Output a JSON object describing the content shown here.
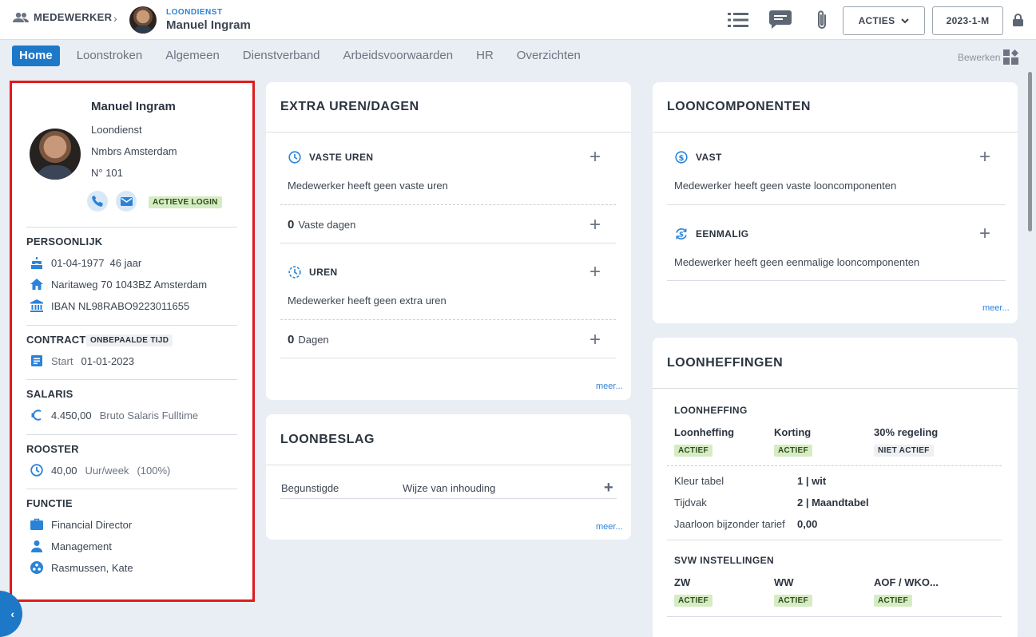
{
  "breadcrumb": {
    "root": "MEDEWERKER",
    "department": "LOONDIENST",
    "employee": "Manuel Ingram"
  },
  "toolbar": {
    "acties": "ACTIES",
    "period": "2023-1-M"
  },
  "tabs": [
    "Home",
    "Loonstroken",
    "Algemeen",
    "Dienstverband",
    "Arbeidsvoorwaarden",
    "HR",
    "Overzichten"
  ],
  "bewerken": "Bewerken",
  "profile": {
    "name": "Manuel Ingram",
    "department": "Loondienst",
    "company": "Nmbrs Amsterdam",
    "number": "N° 101",
    "login_badge": "ACTIEVE LOGIN",
    "persoonlijk": {
      "title": "PERSOONLIJK",
      "birthdate": "01-04-1977",
      "age": "46 jaar",
      "address": "Naritaweg 70 1043BZ Amsterdam",
      "iban": "IBAN NL98RABO9223011655"
    },
    "contract": {
      "title": "CONTRACT",
      "badge": "ONBEPAALDE TIJD",
      "start_label": "Start",
      "start_date": "01-01-2023"
    },
    "salaris": {
      "title": "SALARIS",
      "amount": "4.450,00",
      "type": "Bruto Salaris Fulltime"
    },
    "rooster": {
      "title": "ROOSTER",
      "hours": "40,00",
      "unit": "Uur/week",
      "percent": "(100%)"
    },
    "functie": {
      "title": "FUNCTIE",
      "job": "Financial Director",
      "department": "Management",
      "manager": "Rasmussen, Kate"
    }
  },
  "extra_uren": {
    "title": "EXTRA UREN/DAGEN",
    "vaste_uren": "VASTE UREN",
    "vaste_uren_empty": "Medewerker heeft geen vaste uren",
    "vaste_dagen_count": "0",
    "vaste_dagen_label": "Vaste dagen",
    "uren": "UREN",
    "uren_empty": "Medewerker heeft geen extra uren",
    "dagen_count": "0",
    "dagen_label": "Dagen",
    "meer": "meer..."
  },
  "loonbeslag": {
    "title": "LOONBESLAG",
    "col_begunstigde": "Begunstigde",
    "col_wijze": "Wijze van inhouding",
    "meer": "meer..."
  },
  "looncomponenten": {
    "title": "LOONCOMPONENTEN",
    "vast": "VAST",
    "vast_empty": "Medewerker heeft geen vaste looncomponenten",
    "eenmalig": "EENMALIG",
    "eenmalig_empty": "Medewerker heeft geen eenmalige looncomponenten",
    "meer": "meer..."
  },
  "loonheffingen": {
    "title": "LOONHEFFINGEN",
    "section": "LOONHEFFING",
    "items": [
      {
        "label": "Loonheffing",
        "status": "ACTIEF"
      },
      {
        "label": "Korting",
        "status": "ACTIEF"
      },
      {
        "label": "30% regeling",
        "status": "NIET ACTIEF"
      }
    ],
    "kleur_label": "Kleur tabel",
    "kleur_value": "1 | wit",
    "tijdvak_label": "Tijdvak",
    "tijdvak_value": "2 | Maandtabel",
    "jaarloon_label": "Jaarloon bijzonder tarief",
    "jaarloon_value": "0,00",
    "svw_title": "SVW INSTELLINGEN",
    "svw": [
      {
        "label": "ZW",
        "status": "ACTIEF"
      },
      {
        "label": "WW",
        "status": "ACTIEF"
      },
      {
        "label": "AOF / WKO...",
        "status": "ACTIEF"
      }
    ]
  },
  "colors": {
    "accent": "#1e78c8",
    "highlight": "#e01b1b",
    "badge_green": "#d6ecc3"
  }
}
